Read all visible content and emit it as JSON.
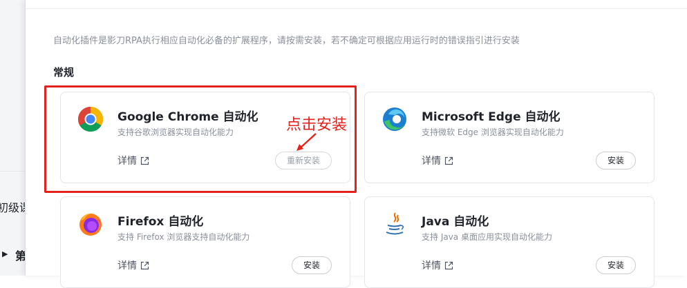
{
  "background_window": {
    "course_text": "初级课",
    "chapter_text": "第"
  },
  "intro": "自动化插件是影刀RPA执行相应自动化必备的扩展程序，请按需安装，若不确定可根据应用运行时的错误指引进行安装",
  "section_title": "常规",
  "detail_label": "详情",
  "plugins": [
    {
      "name": "Google Chrome 自动化",
      "description": "支持谷歌浏览器实现自动化能力",
      "detail_label": "详情",
      "button_label": "重新安装",
      "icon": "chrome-icon"
    },
    {
      "name": "Microsoft Edge 自动化",
      "description": "支持微软 Edge 浏览器实现自动化能力",
      "detail_label": "详情",
      "button_label": "安装",
      "icon": "edge-icon"
    },
    {
      "name": "Firefox 自动化",
      "description": "支持 Firefox 浏览器支持自动化能力",
      "detail_label": "详情",
      "button_label": "安装",
      "icon": "firefox-icon"
    },
    {
      "name": "Java 自动化",
      "description": "支持 Java 桌面应用实现自动化能力",
      "detail_label": "详情",
      "button_label": "安装",
      "icon": "java-icon"
    }
  ],
  "annotation": {
    "text": "点击安装",
    "color": "#e5211d"
  },
  "colors": {
    "highlight": "#e5211d",
    "text_primary": "#1f2329",
    "text_secondary": "#8a8f99"
  }
}
